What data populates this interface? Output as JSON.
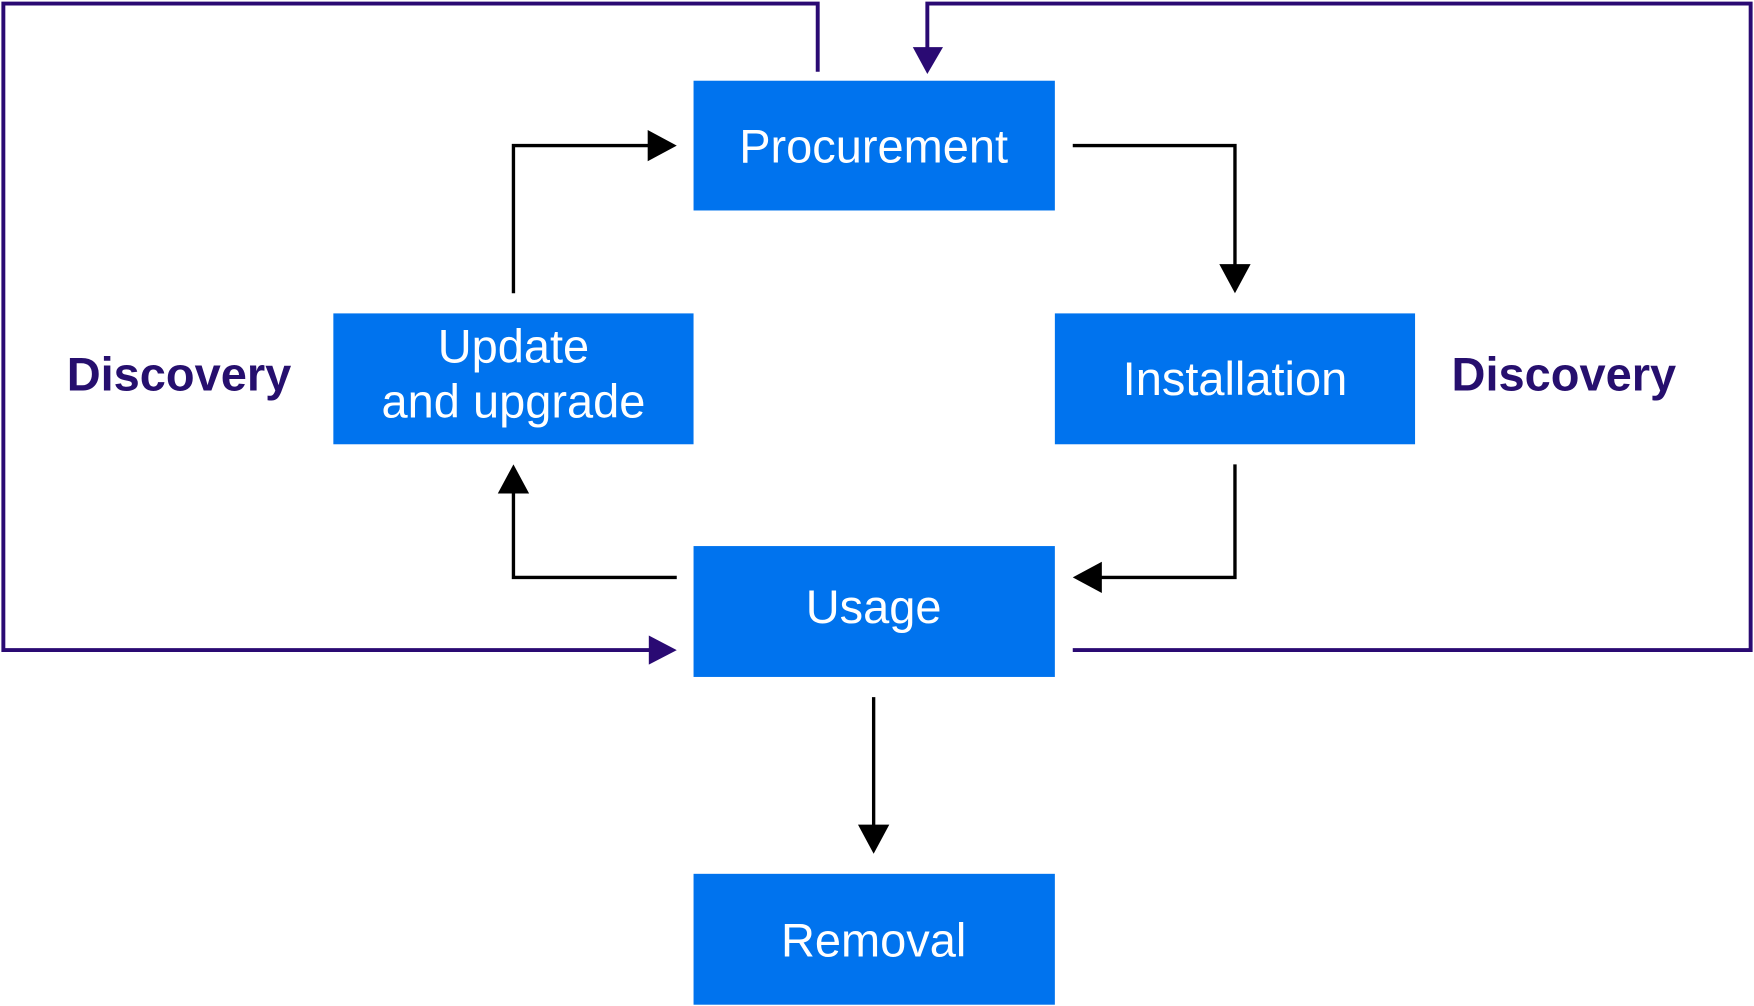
{
  "nodes": {
    "procurement": "Procurement",
    "update_line1": "Update",
    "update_line2": "and upgrade",
    "installation": "Installation",
    "usage": "Usage",
    "removal": "Removal"
  },
  "labels": {
    "discovery_left": "Discovery",
    "discovery_right": "Discovery"
  },
  "colors": {
    "box": "#0073ee",
    "discovery_loop": "#2a0a73",
    "flow_arrow": "#000000"
  }
}
